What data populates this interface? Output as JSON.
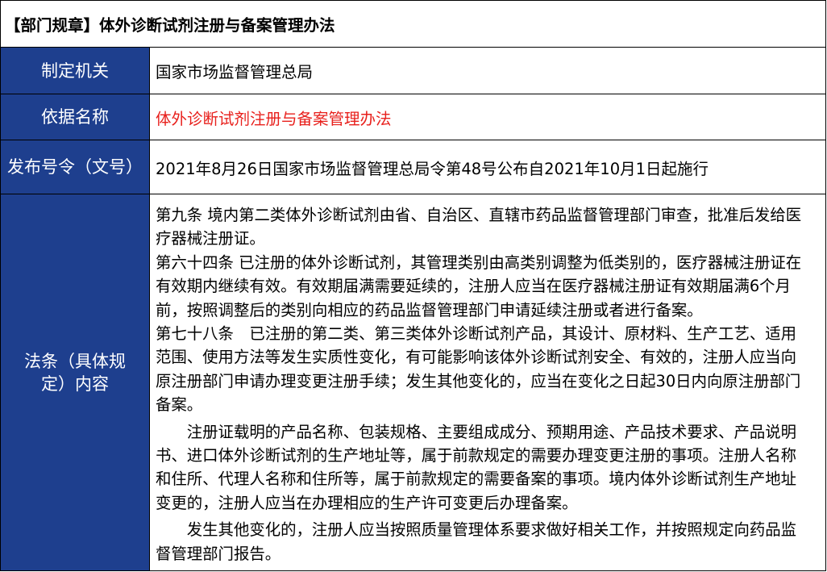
{
  "title": "【部门规章】体外诊断试剂注册与备案管理办法",
  "rows": [
    {
      "label": "制定机关",
      "value": "国家市场监督管理总局"
    },
    {
      "label": "依据名称",
      "value": "体外诊断试剂注册与备案管理办法"
    },
    {
      "label": "发布号令（文号）",
      "value": "2021年8月26日国家市场监督管理总局令第48号公布自2021年10月1日起施行"
    }
  ],
  "content": {
    "label": "法条（具体规定）内容",
    "paragraphs": [
      {
        "lines": [
          "第九条 境内第二类体外诊断试剂由省、自治区、直辖市药品监督管理部门审查，批准后发给医",
          "疗器械注册证。"
        ]
      },
      {
        "lines": [
          "第六十四条 已注册的体外诊断试剂，其管理类别由高类别调整为低类别的，医疗器械注册证在",
          "有效期内继续有效。有效期届满需要延续的，注册人应当在医疗器械注册证有效期届满6个月",
          "前，按照调整后的类别向相应的药品监督管理部门申请延续注册或者进行备案。"
        ]
      },
      {
        "lines": [
          "第七十八条　已注册的第二类、第三类体外诊断试剂产品，其设计、原材料、生产工艺、适用",
          "范围、使用方法等发生实质性变化，有可能影响该体外诊断试剂安全、有效的，注册人应当向",
          "原注册部门申请办理变更注册手续；发生其他变化的，应当在变化之日起30日内向原注册部门",
          "备案。"
        ]
      },
      {
        "lines": [
          "　　注册证载明的产品名称、包装规格、主要组成成分、预期用途、产品技术要求、产品说明",
          "书、进口体外诊断试剂的生产地址等，属于前款规定的需要办理变更注册的事项。注册人名称",
          "和住所、代理人名称和住所等，属于前款规定的需要备案的事项。境内体外诊断试剂生产地址",
          "变更的，注册人应当在办理相应的生产许可变更后办理备案。"
        ]
      },
      {
        "lines": [
          "　　发生其他变化的，注册人应当按照质量管理体系要求做好相关工作，并按照规定向药品监",
          "督管理部门报告。"
        ]
      }
    ]
  },
  "colors": {
    "label_bg": "#1e3f8e",
    "label_text": "#ffffff",
    "accent_text": "#e8201c",
    "border": "#000000"
  }
}
